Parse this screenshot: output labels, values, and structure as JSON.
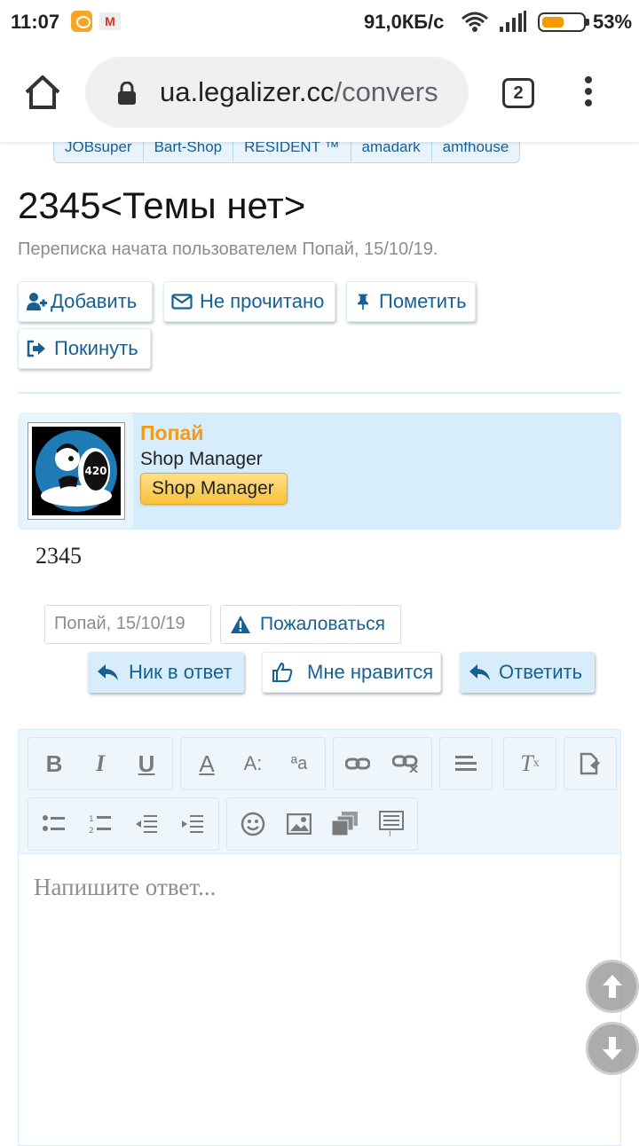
{
  "status_bar": {
    "time": "11:07",
    "net_speed": "91,0КБ/с",
    "battery": "53%",
    "battery_level": 0.53
  },
  "browser": {
    "url_host": "ua.legalizer.cc",
    "url_path": "/convers",
    "tab_count": "2"
  },
  "tags": [
    "JOBsuper",
    "Bart-Shop",
    "RESIDENT ™",
    "amadark",
    "amfhouse"
  ],
  "conversation": {
    "title": "2345<Темы нет>",
    "subtitle": "Переписка начата пользователем Попай, 15/10/19."
  },
  "buttons": {
    "add": "Добавить",
    "unread": "Не прочитано",
    "star": "Пометить",
    "leave": "Покинуть"
  },
  "message": {
    "username": "Попай",
    "user_title": "Shop Manager",
    "user_badge": "Shop Manager",
    "body": "2345",
    "meta_author": "Попай",
    "meta_date": ", 15/10/19",
    "report": "Пожаловаться",
    "quote_nick": "Ник в ответ",
    "like": "Мне нравится",
    "reply": "Ответить"
  },
  "editor": {
    "placeholder": "Напишите ответ..."
  },
  "colors": {
    "link": "#176093",
    "username": "#f09b1a",
    "accent_light": "#d7edfc"
  }
}
